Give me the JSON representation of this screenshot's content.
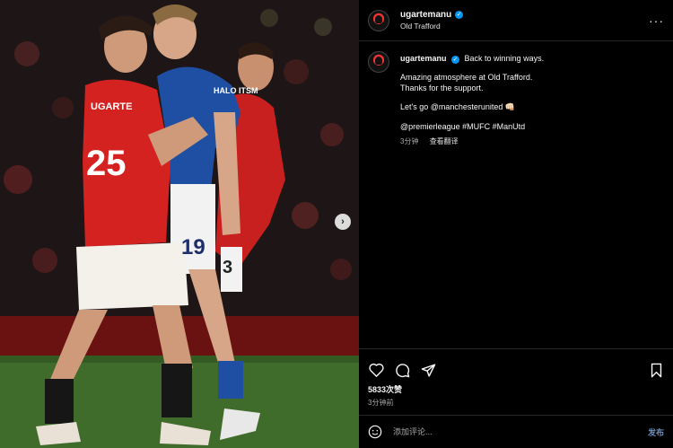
{
  "header": {
    "username": "ugartemanu",
    "location": "Old Trafford"
  },
  "caption": {
    "username": "ugartemanu",
    "line1": "Back to winning ways.",
    "line2": "Amazing atmosphere at Old Trafford.",
    "line3": "Thanks for the support.",
    "line4": "Let's go @manchesterunited 👊🏻",
    "line5": "@premierleague #MUFC #ManUtd",
    "time": "3分钟",
    "translate": "查看翻译"
  },
  "photo": {
    "jersey_number_front": "25",
    "jersey_name": "UGARTE",
    "opponent_number": "19",
    "sponsor": "HALO ITSM",
    "sleeve": "3"
  },
  "actions": {
    "likes": "5833次赞",
    "posted": "3分钟前"
  },
  "comment": {
    "placeholder": "添加评论...",
    "post_label": "发布"
  },
  "colors": {
    "accent_blue": "#0095f6",
    "background": "#000000"
  }
}
